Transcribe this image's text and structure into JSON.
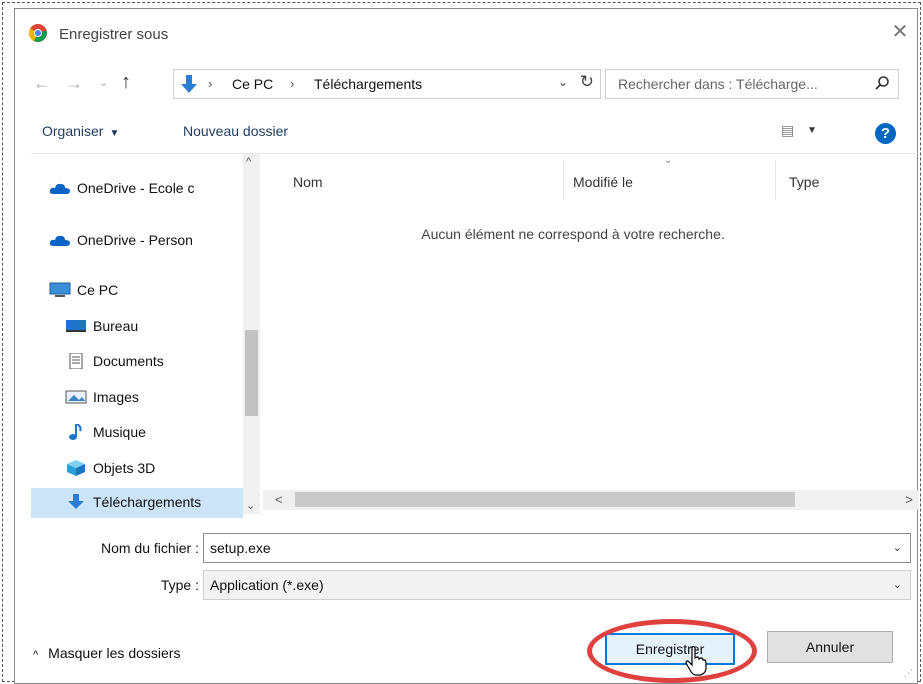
{
  "window": {
    "title": "Enregistrer sous",
    "close_glyph": "✕"
  },
  "nav": {
    "back_glyph": "←",
    "forward_glyph": "→",
    "recent_glyph": "⌄",
    "up_glyph": "↑",
    "breadcrumb": [
      "Ce PC",
      "Téléchargements"
    ],
    "separator": "›",
    "dropdown_glyph": "⌄",
    "refresh_glyph": "↻"
  },
  "search": {
    "placeholder": "Rechercher dans : Télécharge...",
    "icon": "search-icon"
  },
  "toolbar": {
    "organiser_label": "Organiser",
    "organiser_arrow": "▼",
    "new_folder_label": "Nouveau dossier",
    "view_glyph": "▤",
    "view_dd": "▼",
    "help_label": "?"
  },
  "sidebar": {
    "items": [
      {
        "label": "OneDrive - Ecole c",
        "icon": "cloud-icon"
      },
      {
        "label": "OneDrive - Person",
        "icon": "cloud-icon"
      },
      {
        "label": "Ce PC",
        "icon": "computer-icon"
      },
      {
        "label": "Bureau",
        "icon": "desktop-icon"
      },
      {
        "label": "Documents",
        "icon": "document-icon"
      },
      {
        "label": "Images",
        "icon": "image-icon"
      },
      {
        "label": "Musique",
        "icon": "music-note-icon"
      },
      {
        "label": "Objets 3D",
        "icon": "cube-icon"
      },
      {
        "label": "Téléchargements",
        "icon": "download-arrow-icon",
        "selected": true
      }
    ],
    "scroll_up": "^",
    "scroll_down": "⌄"
  },
  "files": {
    "columns": [
      "Nom",
      "Modifié le",
      "Type"
    ],
    "sort_caret": "⌄",
    "empty_message": "Aucun élément ne correspond à votre recherche.",
    "scroll_left": "<",
    "scroll_right": ">"
  },
  "form": {
    "filename_label": "Nom du fichier :",
    "filename_value": "setup.exe",
    "type_label": "Type :",
    "type_value": "Application (*.exe)",
    "dropdown_glyph": "⌄"
  },
  "footer": {
    "hide_folders_label": "Masquer les dossiers",
    "hide_folders_chevron": "^",
    "save_label": "Enregistrer",
    "cancel_label": "Annuler"
  },
  "colors": {
    "accent": "#0078d7",
    "highlight": "#e0413f",
    "selection": "#cce4f7"
  }
}
